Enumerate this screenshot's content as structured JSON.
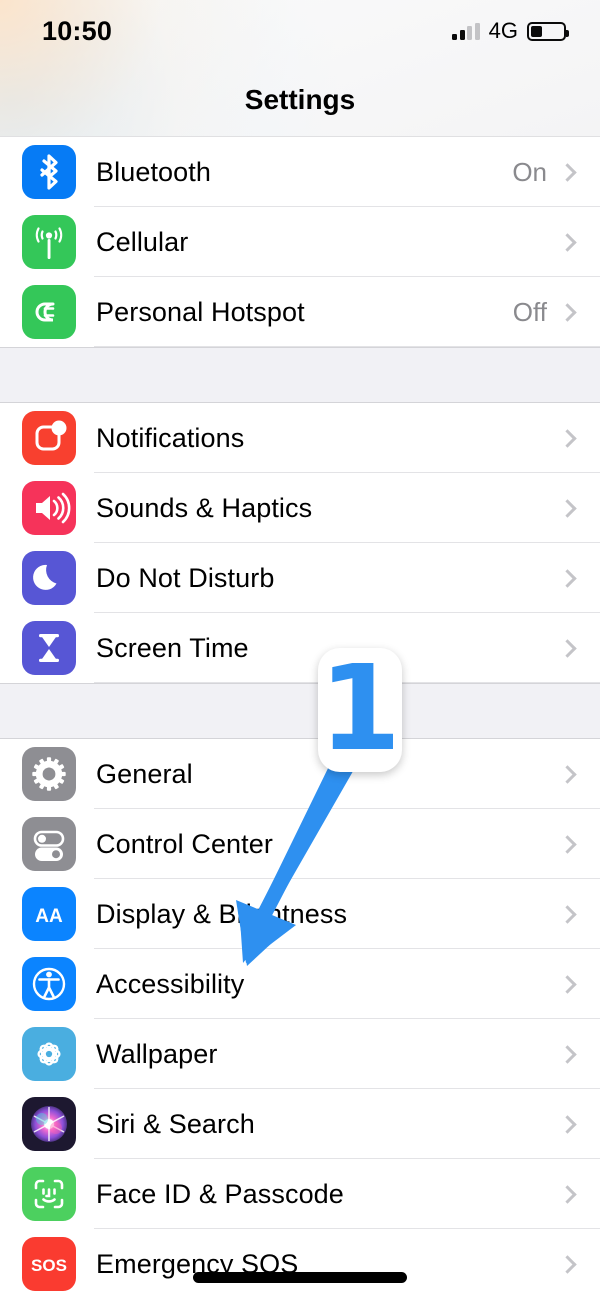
{
  "status_bar": {
    "time": "10:50",
    "network": "4G",
    "signal_icon": "cellular-signal-icon",
    "battery_icon": "battery-icon",
    "battery_level_percent": 36
  },
  "header": {
    "title": "Settings"
  },
  "annotation": {
    "step_number": "1",
    "arrow_icon": "arrow-down-left-icon",
    "accent_color": "#2e90f0",
    "points_to": "Accessibility"
  },
  "home_indicator": "home-indicator",
  "sections": [
    {
      "rows": [
        {
          "label": "Bluetooth",
          "value": "On",
          "icon": "bluetooth-icon",
          "icon_color": "#067bf5"
        },
        {
          "label": "Cellular",
          "value": "",
          "icon": "cellular-icon",
          "icon_color": "#34c759"
        },
        {
          "label": "Personal Hotspot",
          "value": "Off",
          "icon": "hotspot-icon",
          "icon_color": "#34c759"
        }
      ]
    },
    {
      "rows": [
        {
          "label": "Notifications",
          "value": "",
          "icon": "notifications-icon",
          "icon_color": "#f8402f"
        },
        {
          "label": "Sounds & Haptics",
          "value": "",
          "icon": "sounds-icon",
          "icon_color": "#f6335a"
        },
        {
          "label": "Do Not Disturb",
          "value": "",
          "icon": "moon-icon",
          "icon_color": "#5756d5"
        },
        {
          "label": "Screen Time",
          "value": "",
          "icon": "hourglass-icon",
          "icon_color": "#5756d5"
        }
      ]
    },
    {
      "rows": [
        {
          "label": "General",
          "value": "",
          "icon": "gear-icon",
          "icon_color": "#8e8e93"
        },
        {
          "label": "Control Center",
          "value": "",
          "icon": "toggles-icon",
          "icon_color": "#8e8e93"
        },
        {
          "label": "Display & Brightness",
          "value": "",
          "icon": "display-aa-icon",
          "icon_color": "#0b84ff"
        },
        {
          "label": "Accessibility",
          "value": "",
          "icon": "accessibility-icon",
          "icon_color": "#0b84ff"
        },
        {
          "label": "Wallpaper",
          "value": "",
          "icon": "wallpaper-icon",
          "icon_color": "#4aaee0"
        },
        {
          "label": "Siri & Search",
          "value": "",
          "icon": "siri-icon",
          "icon_color": "#1d1830"
        },
        {
          "label": "Face ID & Passcode",
          "value": "",
          "icon": "face-id-icon",
          "icon_color": "#4cd05f"
        },
        {
          "label": "Emergency SOS",
          "value": "",
          "icon": "sos-icon",
          "icon_color": "#fa3b30"
        }
      ]
    }
  ],
  "chevron_icon": "chevron-right-icon"
}
